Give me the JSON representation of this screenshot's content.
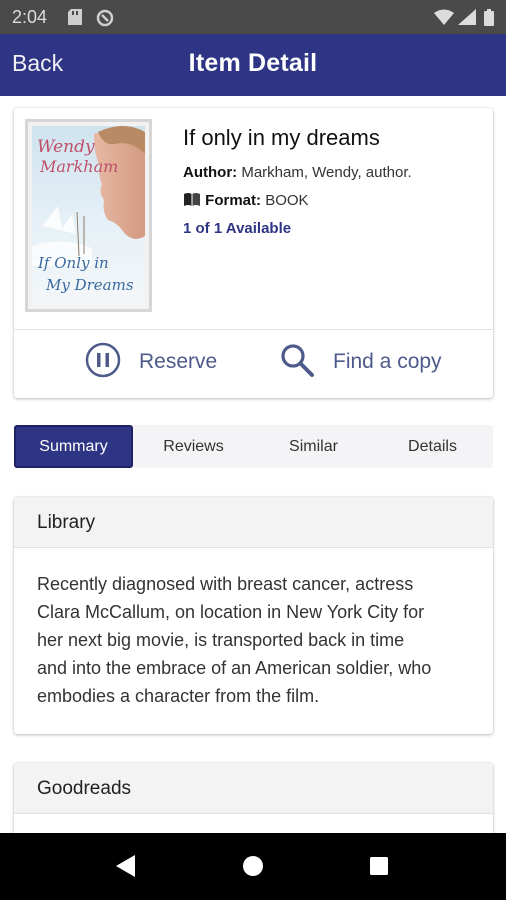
{
  "status_bar": {
    "time": "2:04"
  },
  "app_bar": {
    "back_label": "Back",
    "title": "Item Detail"
  },
  "item": {
    "title": "If only in my dreams",
    "author_label": "Author:",
    "author": "Markham, Wendy, author.",
    "format_label": "Format:",
    "format": "BOOK",
    "availability": "1 of 1 Available",
    "cover": {
      "author_text_line1": "Wendy",
      "author_text_line2": "Markham",
      "title_text_line1": "If Only in",
      "title_text_line2": "My Dreams"
    }
  },
  "actions": {
    "reserve_label": "Reserve",
    "find_label": "Find a copy"
  },
  "tabs": [
    {
      "label": "Summary",
      "active": true
    },
    {
      "label": "Reviews",
      "active": false
    },
    {
      "label": "Similar",
      "active": false
    },
    {
      "label": "Details",
      "active": false
    }
  ],
  "library": {
    "heading": "Library",
    "summary_lines": [
      "Recently diagnosed with breast cancer, actress",
      "Clara McCallum, on location in New York City for",
      "her next big movie, is transported back in time",
      "and into the embrace of an American soldier, who",
      "embodies a character from the film."
    ]
  },
  "goodreads": {
    "heading": "Goodreads"
  },
  "colors": {
    "primary": "#2f3585",
    "action_text": "#4d5a8a",
    "status_bar": "#4a4a4a"
  }
}
